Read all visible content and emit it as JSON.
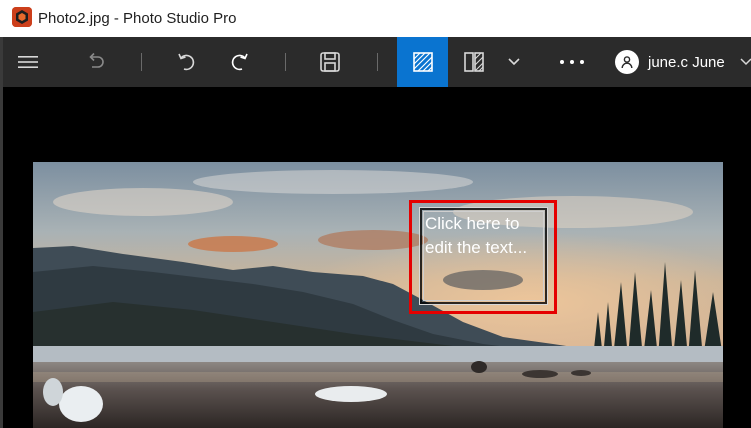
{
  "window": {
    "title": "Photo2.jpg - Photo Studio Pro",
    "app_icon": "photo-studio-app-icon"
  },
  "toolbar": {
    "items": [
      {
        "name": "menu-button",
        "icon": "hamburger-icon"
      },
      {
        "name": "undo-disabled-button",
        "icon": "undo-icon"
      },
      {
        "name": "rotate-left-button",
        "icon": "rotate-left-icon"
      },
      {
        "name": "rotate-right-button",
        "icon": "rotate-right-icon"
      },
      {
        "name": "save-button",
        "icon": "save-icon"
      },
      {
        "name": "crop-view-button",
        "icon": "hatch-square-icon",
        "active": true
      },
      {
        "name": "compare-view-button",
        "icon": "split-view-icon"
      },
      {
        "name": "view-options-dropdown",
        "icon": "chevron-down-icon"
      },
      {
        "name": "more-options-button",
        "icon": "more-dots-icon"
      }
    ],
    "active_color": "#0a74d0",
    "background_color": "#2b2b2b"
  },
  "user": {
    "name": "june.c June",
    "avatar_icon": "person-icon"
  },
  "canvas": {
    "text_box": {
      "placeholder_text": "Click here to edit the text..."
    },
    "selection_border_color": "#e50000"
  }
}
